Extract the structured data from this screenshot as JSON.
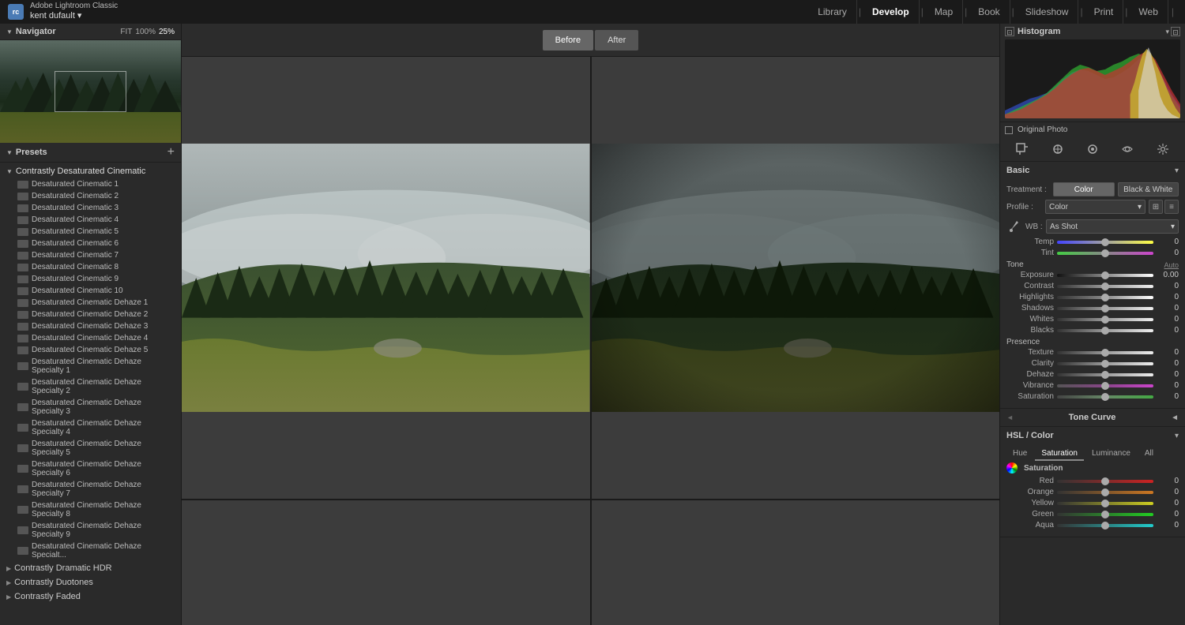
{
  "app": {
    "icon_text": "rc",
    "name": "Adobe Lightroom Classic",
    "user": "kent dufault",
    "user_arrow": "▾"
  },
  "nav": {
    "items": [
      {
        "label": "Library",
        "active": false
      },
      {
        "label": "Develop",
        "active": true
      },
      {
        "label": "Map",
        "active": false
      },
      {
        "label": "Book",
        "active": false
      },
      {
        "label": "Slideshow",
        "active": false
      },
      {
        "label": "Print",
        "active": false
      },
      {
        "label": "Web",
        "active": false
      }
    ]
  },
  "navigator": {
    "title": "Navigator",
    "zoom_fit": "FIT",
    "zoom_100": "100%",
    "zoom_25": "25%"
  },
  "presets": {
    "title": "Presets",
    "add_icon": "+",
    "groups": [
      {
        "name": "Contrastly Desaturated Cinematic",
        "expanded": true,
        "items": [
          "Desaturated Cinematic 1",
          "Desaturated Cinematic 2",
          "Desaturated Cinematic 3",
          "Desaturated Cinematic 4",
          "Desaturated Cinematic 5",
          "Desaturated Cinematic 6",
          "Desaturated Cinematic 7",
          "Desaturated Cinematic 8",
          "Desaturated Cinematic 9",
          "Desaturated Cinematic 10",
          "Desaturated Cinematic Dehaze 1",
          "Desaturated Cinematic Dehaze 2",
          "Desaturated Cinematic Dehaze 3",
          "Desaturated Cinematic Dehaze 4",
          "Desaturated Cinematic Dehaze 5",
          "Desaturated Cinematic Dehaze Specialty 1",
          "Desaturated Cinematic Dehaze Specialty 2",
          "Desaturated Cinematic Dehaze Specialty 3",
          "Desaturated Cinematic Dehaze Specialty 4",
          "Desaturated Cinematic Dehaze Specialty 5",
          "Desaturated Cinematic Dehaze Specialty 6",
          "Desaturated Cinematic Dehaze Specialty 7",
          "Desaturated Cinematic Dehaze Specialty 8",
          "Desaturated Cinematic Dehaze Specialty 9",
          "Desaturated Cinematic Dehaze Specialt..."
        ]
      },
      {
        "name": "Contrastly Dramatic HDR",
        "expanded": false,
        "items": []
      },
      {
        "name": "Contrastly Duotones",
        "expanded": false,
        "items": []
      },
      {
        "name": "Contrastly Faded",
        "expanded": false,
        "items": []
      }
    ]
  },
  "toolbar": {
    "before_label": "Before",
    "after_label": "After"
  },
  "histogram": {
    "title": "Histogram",
    "expand_icon": "▾",
    "corner_icons": [
      "◱",
      "◳"
    ]
  },
  "original_photo": {
    "label": "Original Photo"
  },
  "tools": {
    "icons": [
      "⊡",
      "✏",
      "◎",
      "⚙"
    ]
  },
  "basic": {
    "title": "Basic",
    "expand_icon": "▾",
    "treatment": {
      "label": "Treatment :",
      "color": "Color",
      "bw": "Black & White"
    },
    "profile": {
      "label": "Profile :",
      "value": "Color",
      "arrow": "▾",
      "grid_icon": "⊞",
      "menu_icon": "≡"
    },
    "wb": {
      "label": "WB :",
      "value": "As Shot",
      "arrow": "▾"
    },
    "temp": {
      "label": "Temp",
      "value": "0"
    },
    "tint": {
      "label": "Tint",
      "value": "0"
    },
    "tone_label": "Tone",
    "auto_label": "Auto",
    "exposure": {
      "label": "Exposure",
      "value": "0.00"
    },
    "contrast": {
      "label": "Contrast",
      "value": "0"
    },
    "highlights": {
      "label": "Highlights",
      "value": "0"
    },
    "shadows": {
      "label": "Shadows",
      "value": "0"
    },
    "whites": {
      "label": "Whites",
      "value": "0"
    },
    "blacks": {
      "label": "Blacks",
      "value": "0"
    },
    "presence_label": "Presence",
    "texture": {
      "label": "Texture",
      "value": "0"
    },
    "clarity": {
      "label": "Clarity",
      "value": "0"
    },
    "dehaze": {
      "label": "Dehaze",
      "value": "0"
    },
    "vibrance": {
      "label": "Vibrance",
      "value": "0"
    },
    "saturation": {
      "label": "Saturation",
      "value": "0"
    }
  },
  "tone_curve": {
    "title": "Tone Curve",
    "expand_icon": "◄"
  },
  "hsl": {
    "title": "HSL / Color",
    "expand_icon": "▾",
    "tabs": [
      "Hue",
      "Saturation",
      "Luminance",
      "All"
    ],
    "active_tab": "Saturation",
    "section_label": "Saturation",
    "sat_icon": "●",
    "red": {
      "label": "Red",
      "value": "0"
    },
    "orange": {
      "label": "Orange",
      "value": "0"
    },
    "yellow": {
      "label": "Yellow",
      "value": "0"
    },
    "green": {
      "label": "Green",
      "value": "0"
    },
    "aqua": {
      "label": "Aqua",
      "value": "0"
    }
  }
}
